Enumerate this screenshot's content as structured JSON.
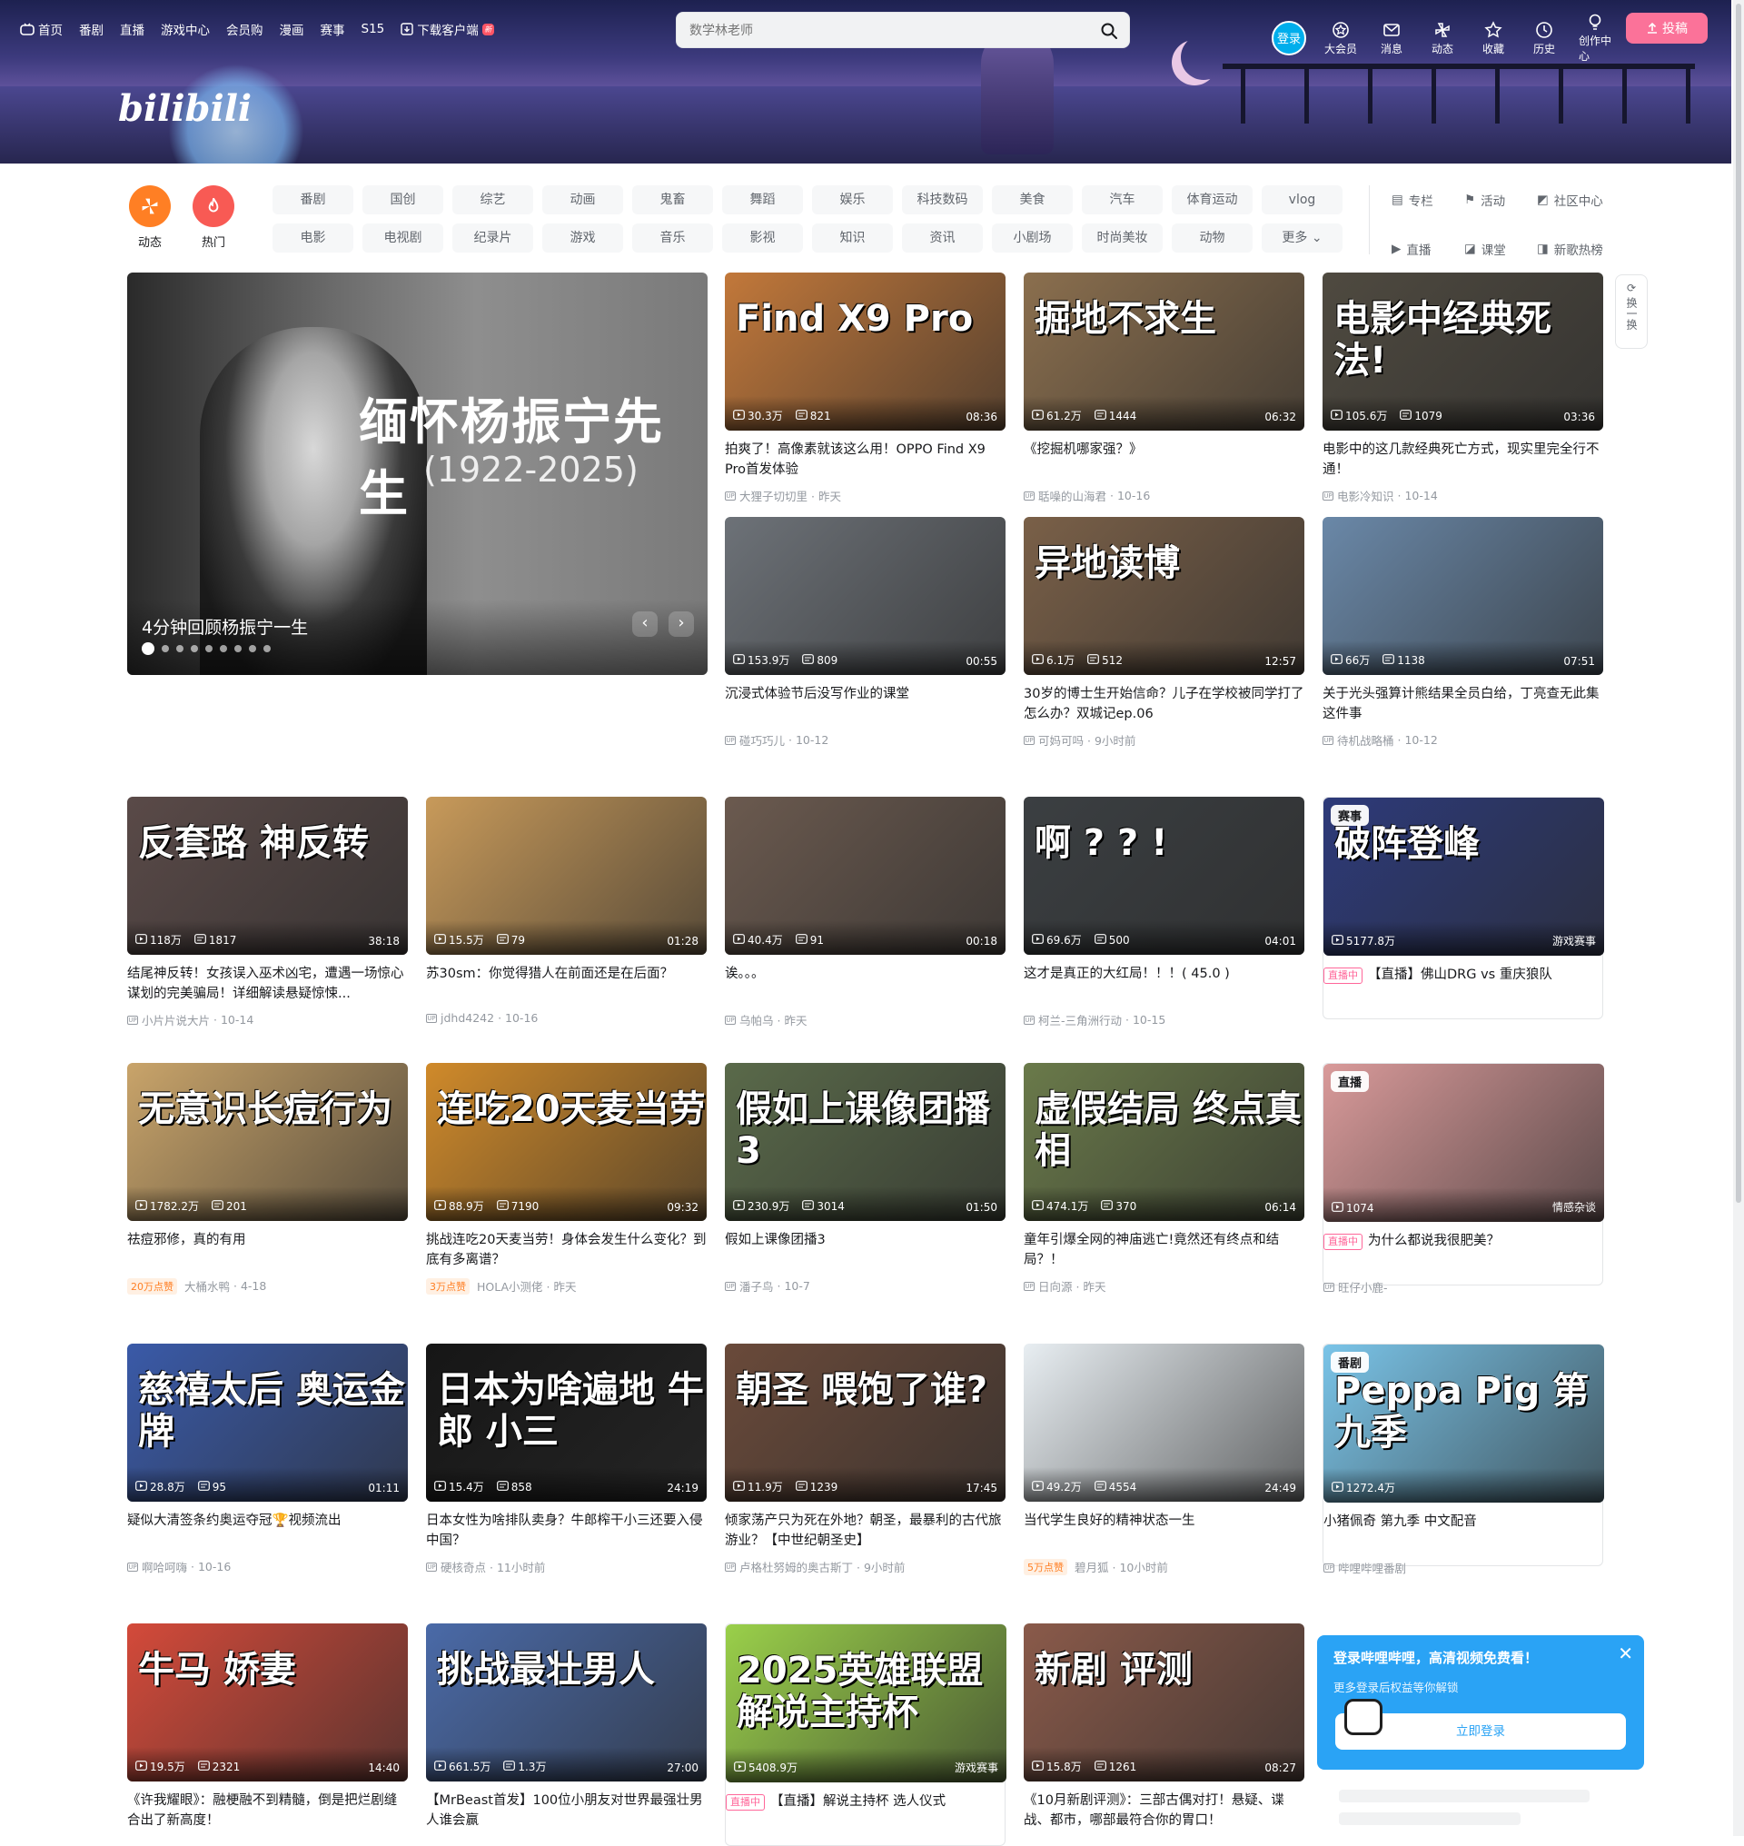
{
  "nav": {
    "items": [
      "首页",
      "番剧",
      "直播",
      "游戏中心",
      "会员购",
      "漫画",
      "赛事",
      "S15",
      "下载客户端"
    ],
    "new_badge": "新"
  },
  "search": {
    "placeholder": "数学林老师"
  },
  "right_nav": {
    "login": "登录",
    "items": [
      "大会员",
      "消息",
      "动态",
      "收藏",
      "历史",
      "创作中心"
    ],
    "upload": "投稿"
  },
  "logo": "bilibili",
  "channels": {
    "dynamic": "动态",
    "hot": "热门",
    "tags": [
      "番剧",
      "国创",
      "综艺",
      "动画",
      "鬼畜",
      "舞蹈",
      "娱乐",
      "科技数码",
      "美食",
      "汽车",
      "体育运动",
      "vlog",
      "电影",
      "电视剧",
      "纪录片",
      "游戏",
      "音乐",
      "影视",
      "知识",
      "资讯",
      "小剧场",
      "时尚美妆",
      "动物",
      "更多"
    ],
    "links": [
      "专栏",
      "活动",
      "社区中心",
      "直播",
      "课堂",
      "新歌热榜"
    ]
  },
  "hero": {
    "title": "缅怀杨振宁先生",
    "subtitle": "(1922-2025)",
    "caption": "4分钟回顾杨振宁一生",
    "prev": "‹",
    "next": "›"
  },
  "refresh": {
    "label": "换一换"
  },
  "cards": [
    {
      "title": "拍爽了！高像素就该这么用！OPPO Find X9 Pro首发体验",
      "author": "大狸子切切里",
      "date": "昨天",
      "views": "30.3万",
      "danmaku": "821",
      "duration": "08:36",
      "cover": "Find X9 Pro",
      "color": "#c2783a"
    },
    {
      "title": "《挖掘机哪家强？》",
      "author": "聒噪的山海君",
      "date": "10-16",
      "views": "61.2万",
      "danmaku": "1444",
      "duration": "06:32",
      "cover": "掘地不求生",
      "color": "#8b6f4e"
    },
    {
      "title": "电影中的这几款经典死亡方式，现实里完全行不通！",
      "author": "电影冷知识",
      "date": "10-14",
      "views": "105.6万",
      "danmaku": "1079",
      "duration": "03:36",
      "cover": "电影中经典死法!",
      "color": "#4f4a40"
    },
    {
      "title": "沉浸式体验节后没写作业的课堂",
      "author": "碰巧巧儿",
      "date": "10-12",
      "views": "153.9万",
      "danmaku": "809",
      "duration": "00:55",
      "cover": "",
      "color": "#6d7278"
    },
    {
      "title": "30岁的博士生开始信命？儿子在学校被同学打了怎么办？双城记ep.06",
      "author": "可妈可吗",
      "date": "9小时前",
      "views": "6.1万",
      "danmaku": "512",
      "duration": "12:57",
      "cover": "异地读博",
      "color": "#7a6048"
    },
    {
      "title": "关于光头强算计熊结果全员白给，丁亮查无此集这件事",
      "author": "待机战略桶",
      "date": "10-12",
      "views": "66万",
      "danmaku": "1138",
      "duration": "07:51",
      "cover": "",
      "color": "#6a88a8"
    },
    {
      "title": "结尾神反转！女孩误入巫术凶宅，遭遇一场惊心谋划的完美骗局！详细解读悬疑惊悚...",
      "author": "小片片说大片",
      "date": "10-14",
      "views": "118万",
      "danmaku": "1817",
      "duration": "38:18",
      "cover": "反套路 神反转",
      "color": "#5a4a48"
    },
    {
      "title": "苏30sm：你觉得猎人在前面还是在后面？",
      "author": "jdhd4242",
      "date": "10-16",
      "views": "15.5万",
      "danmaku": "79",
      "duration": "01:28",
      "cover": "",
      "color": "#c89a5a"
    },
    {
      "title": "诶。。。",
      "author": "乌帕乌",
      "date": "昨天",
      "views": "40.4万",
      "danmaku": "91",
      "duration": "00:18",
      "cover": "",
      "color": "#6b5a4f"
    },
    {
      "title": "这才是真正的大红局！！！( 45.0 )",
      "author": "柯兰-三角洲行动",
      "date": "10-15",
      "views": "69.6万",
      "danmaku": "500",
      "duration": "04:01",
      "cover": "啊 ? ? !",
      "color": "#3b3f42"
    },
    {
      "title": "【直播】佛山DRG vs 重庆狼队",
      "author": "",
      "date": "",
      "views": "5177.8万",
      "danmaku": "",
      "duration": "游戏赛事",
      "cover": "破阵登峰",
      "color": "#2d3a7a",
      "pill": "赛事",
      "live": "直播中"
    },
    {
      "title": "祛痘邪修，真的有用",
      "author": "大桶水鸭",
      "date": "4-18",
      "views": "1782.2万",
      "danmaku": "201",
      "duration": "",
      "cover": "无意识长痘行为",
      "color": "#c9a46a",
      "tag": "20万点赞"
    },
    {
      "title": "挑战连吃20天麦当劳！身体会发生什么变化？到底有多离谱？",
      "author": "HOLA小测佬",
      "date": "昨天",
      "views": "88.9万",
      "danmaku": "7190",
      "duration": "09:32",
      "cover": "连吃20天麦当劳",
      "color": "#d08a2a",
      "tag": "3万点赞"
    },
    {
      "title": "假如上课像团播3",
      "author": "潘子鸟",
      "date": "10-7",
      "views": "230.9万",
      "danmaku": "3014",
      "duration": "01:50",
      "cover": "假如上课像团播3",
      "color": "#5a6a4a"
    },
    {
      "title": "童年引爆全网的神庙逃亡!竟然还有终点和结局？！",
      "author": "日向源",
      "date": "昨天",
      "views": "474.1万",
      "danmaku": "370",
      "duration": "06:14",
      "cover": "虚假结局 终点真相",
      "color": "#6a7a4a"
    },
    {
      "title": "为什么都说我很肥美？",
      "author": "旺仔小鹿-",
      "date": "",
      "views": "1074",
      "danmaku": "",
      "duration": "情感杂谈",
      "cover": "",
      "color": "#d99a9a",
      "pill": "直播",
      "live": "直播中"
    },
    {
      "title": "疑似大清签条约奥运夺冠🏆视频流出",
      "author": "啊哈呵嗨",
      "date": "10-16",
      "views": "28.8万",
      "danmaku": "95",
      "duration": "01:11",
      "cover": "慈禧太后 奥运金牌",
      "color": "#3a5aa8"
    },
    {
      "title": "日本女性为啥排队卖身？牛郎榨干小三还要入侵中国？",
      "author": "硬核奇点",
      "date": "11小时前",
      "views": "15.4万",
      "danmaku": "858",
      "duration": "24:19",
      "cover": "日本为啥遍地 牛郎 小三",
      "color": "#161616"
    },
    {
      "title": "倾家荡产只为死在外地？朝圣，最暴利的古代旅游业？【中世纪朝圣史】",
      "author": "卢格杜努姆的奥古斯丁",
      "date": "9小时前",
      "views": "11.9万",
      "danmaku": "1239",
      "duration": "17:45",
      "cover": "朝圣 喂饱了谁?",
      "color": "#6a4a3a"
    },
    {
      "title": "当代学生良好的精神状态一生",
      "author": "碧月狐",
      "date": "10小时前",
      "views": "49.2万",
      "danmaku": "4554",
      "duration": "24:49",
      "cover": "",
      "color": "#e8eef2",
      "tag": "5万点赞"
    },
    {
      "title": "小猪佩奇 第九季 中文配音",
      "author": "哔哩哔哩番剧",
      "date": "",
      "views": "1272.4万",
      "danmaku": "",
      "duration": "",
      "cover": "Peppa Pig 第九季",
      "color": "#7ac4e8",
      "pill": "番剧"
    },
    {
      "title": "《许我耀眼》：融梗融不到精髓，倒是把烂剧缝合出了新高度！",
      "author": "",
      "date": "",
      "views": "19.5万",
      "danmaku": "2321",
      "duration": "14:40",
      "cover": "牛马 娇妻",
      "color": "#d44a3a"
    },
    {
      "title": "【MrBeast首发】100位小朋友对世界最强壮男人谁会赢",
      "author": "",
      "date": "",
      "views": "661.5万",
      "danmaku": "1.3万",
      "duration": "27:00",
      "cover": "挑战最壮男人",
      "color": "#4a6aa8"
    },
    {
      "title": "【直播】解说主持杯 选人仪式",
      "author": "",
      "date": "",
      "views": "5408.9万",
      "danmaku": "",
      "duration": "游戏赛事",
      "cover": "2025英雄联盟解说主持杯",
      "color": "#9ad04a",
      "live": "直播中"
    },
    {
      "title": "《10月新剧评测》：三部古偶对打！悬疑、谍战、都市，哪部最符合你的胃口！",
      "author": "",
      "date": "",
      "views": "15.8万",
      "danmaku": "1261",
      "duration": "08:27",
      "cover": "新剧 评测",
      "color": "#8a5a4a"
    }
  ],
  "popup": {
    "title": "登录哔哩哔哩，高清视频免费看！",
    "subtitle": "更多登录后权益等你解锁",
    "button": "立即登录",
    "close": "✕"
  }
}
